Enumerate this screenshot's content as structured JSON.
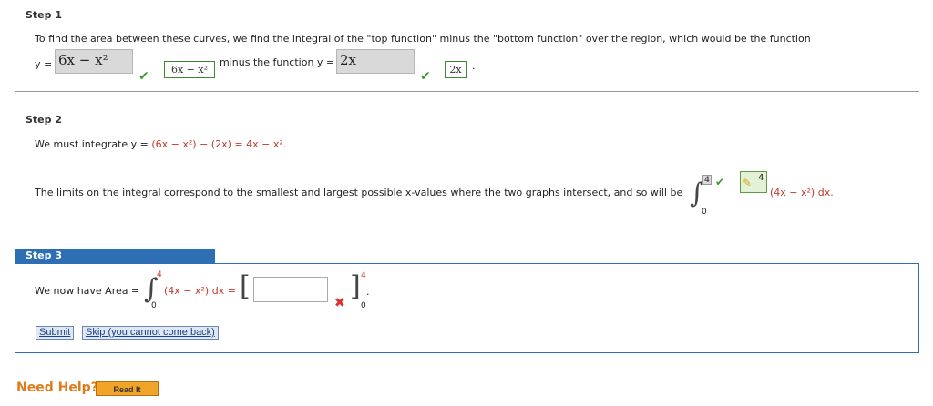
{
  "step1": {
    "title": "Step 1",
    "intro": "To find the area between these curves, we find the integral of the \"top function\" minus the \"bottom function\" over the region, which would be the function",
    "y_label": "y =",
    "answer1": "6x − x²",
    "correct1": "6x − x²",
    "minus_text": "minus the function y =",
    "answer2": "2x",
    "correct2": "2x",
    "period": "."
  },
  "step2": {
    "title": "Step 2",
    "integrate_prefix": "We must integrate y = ",
    "integrate_expr": "(6x − x²) − (2x) = 4x − x².",
    "limits_text": "The limits on the integral correspond to the smallest and largest possible x-values where the two graphs intersect, and so will be",
    "upper_value": "4",
    "lower_value": "0",
    "hint_value": "4",
    "integrand": "(4x − x²) dx."
  },
  "step3": {
    "title": "Step 3",
    "area_prefix": "We now have Area =",
    "upper": "4",
    "lower": "0",
    "integrand": "(4x − x²) dx =",
    "input_value": "",
    "eval_upper": "4",
    "eval_lower": "0",
    "dot": "."
  },
  "buttons": {
    "submit": "Submit",
    "skip": "Skip (you cannot come back)"
  },
  "help": {
    "title": "Need Help?",
    "read_it": "Read It"
  }
}
